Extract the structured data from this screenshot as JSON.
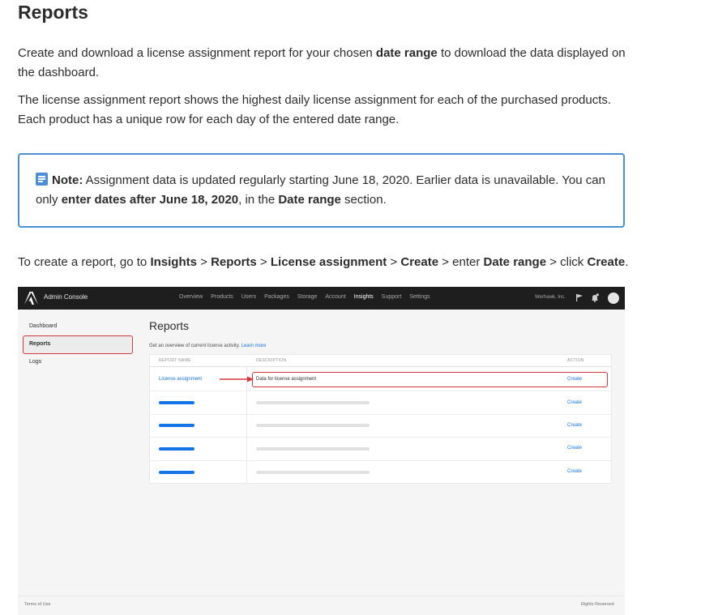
{
  "title": "Reports",
  "intro": {
    "p1_a": "Create and download a license assignment report for your chosen ",
    "p1_b": "date range",
    "p1_c": " to download the data displayed on the dashboard.",
    "p2": "The license assignment report shows the highest daily license assignment for each of the purchased products. Each product has a unique row for each day of the entered date range."
  },
  "note": {
    "label": "Note:",
    "text_a": " Assignment data is updated regularly starting June 18, 2020. Earlier data is unavailable. You can only ",
    "text_b": "enter dates after June 18, 2020",
    "text_c": ", in the ",
    "text_d": "Date range",
    "text_e": " section.",
    "icon": "note-icon"
  },
  "steps": {
    "lead": "To create a report, go to ",
    "s1": "Insights",
    "sep1": " > ",
    "s2": "Reports",
    "sep2": " > ",
    "s3": "License assignment",
    "sep3": " > ",
    "s4": "Create",
    "sep4": " > enter ",
    "s5": "Date range",
    "sep5": " > click ",
    "s6": "Create",
    "end": "."
  },
  "screenshot": {
    "app_name": "Admin Console",
    "nav": [
      "Overview",
      "Products",
      "Users",
      "Packages",
      "Storage",
      "Account",
      "Insights",
      "Support",
      "Settings"
    ],
    "active_nav": "Insights",
    "org": "Werhawk, Inc.",
    "sidebar": [
      "Dashboard",
      "Reports",
      "Logs"
    ],
    "heading": "Reports",
    "subtitle": "Get an overview of current license activity.",
    "learn_more": "Learn more",
    "columns": [
      "REPORT NAME",
      "DESCRIPTION",
      "ACTION"
    ],
    "row1": {
      "name": "License assignment",
      "description": "Data for license assignment",
      "action": "Create"
    },
    "placeholder_actions": [
      "Create",
      "Create",
      "Create",
      "Create"
    ],
    "footer_left": "Terms of Use",
    "footer_right": "Rights Reserved",
    "highlight_color": "#d7373f",
    "link_color": "#1473e6"
  }
}
